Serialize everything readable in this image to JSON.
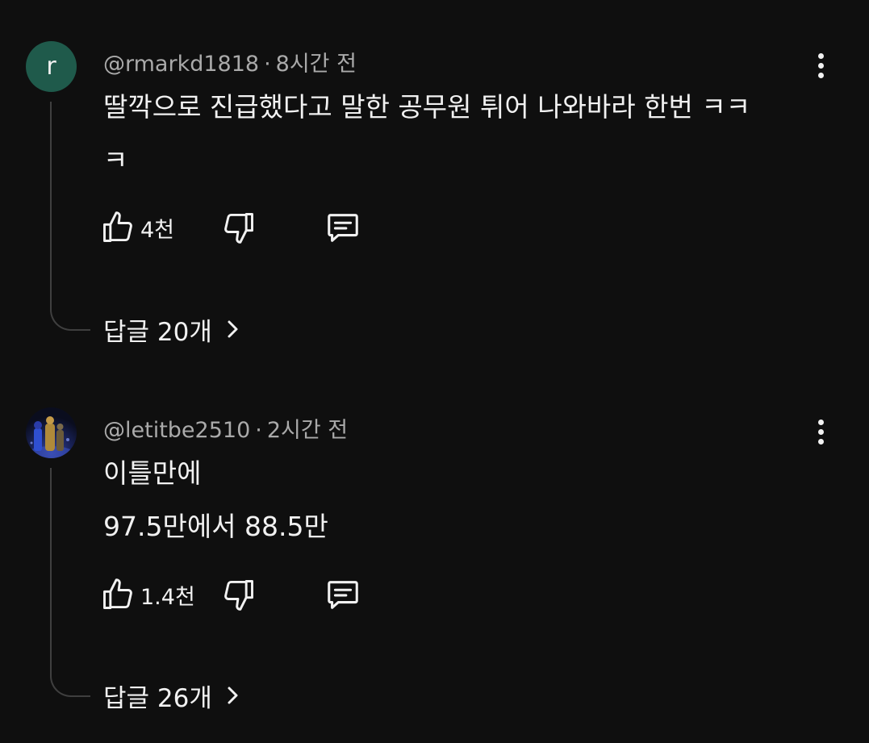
{
  "comments": [
    {
      "avatar_letter": "r",
      "avatar_color": "#1f5a4b",
      "handle": "@rmarkd1818",
      "time": "8시간 전",
      "lines": [
        "딸깍으로 진급했다고 말한 공무원 튀어 나와바라 한번 ㅋㅋ",
        "ㅋ"
      ],
      "likes": "4천",
      "replies_label": "답글 20개"
    },
    {
      "avatar_type": "photo",
      "handle": "@letitbe2510",
      "time": "2시간 전",
      "lines": [
        "이틀만에",
        "97.5만에서 88.5만"
      ],
      "likes": "1.4천",
      "replies_label": "답글 26개"
    }
  ],
  "separator": "·",
  "icons": {
    "like": "thumbs-up-icon",
    "dislike": "thumbs-down-icon",
    "reply": "comment-icon",
    "more": "more-vert-icon",
    "chevron": "chevron-right-icon"
  },
  "colors": {
    "background": "#0f0f0f",
    "text": "#f1f1f1",
    "meta": "#aaaaaa",
    "thread_line": "#3f3f3f"
  }
}
